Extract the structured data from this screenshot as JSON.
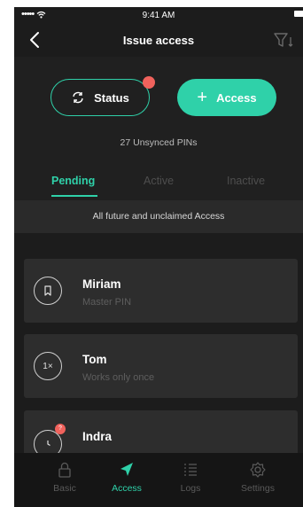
{
  "status_bar": {
    "signal": "•••••",
    "time": "9:41 AM"
  },
  "nav": {
    "title": "Issue access",
    "back_icon": "chevron-left-icon",
    "filter_icon": "filter-sort-icon"
  },
  "actions": {
    "status_label": "Status",
    "access_label": "Access",
    "access_plus": "+",
    "unsynced_text": "27 Unsynced PINs"
  },
  "tabs": [
    {
      "label": "Pending",
      "selected": true
    },
    {
      "label": "Active",
      "selected": false
    },
    {
      "label": "Inactive",
      "selected": false
    }
  ],
  "section_label": "All future and unclaimed Access",
  "list": [
    {
      "name": "Miriam",
      "subtitle": "Master PIN",
      "icon": "bookmark-icon"
    },
    {
      "name": "Tom",
      "subtitle": "Works only once",
      "icon": "once-icon",
      "icon_text": "1×"
    },
    {
      "name": "Indra",
      "subtitle": "",
      "icon": "clock-icon",
      "badge": "?"
    }
  ],
  "tab_bar": [
    {
      "label": "Basic",
      "icon": "lock-icon",
      "active": false
    },
    {
      "label": "Access",
      "icon": "send-icon",
      "active": true
    },
    {
      "label": "Logs",
      "icon": "list-icon",
      "active": false
    },
    {
      "label": "Settings",
      "icon": "gear-icon",
      "active": false
    }
  ],
  "colors": {
    "accent": "#2fd1a9",
    "alert": "#f0625c",
    "background": "#1c1c1c"
  }
}
